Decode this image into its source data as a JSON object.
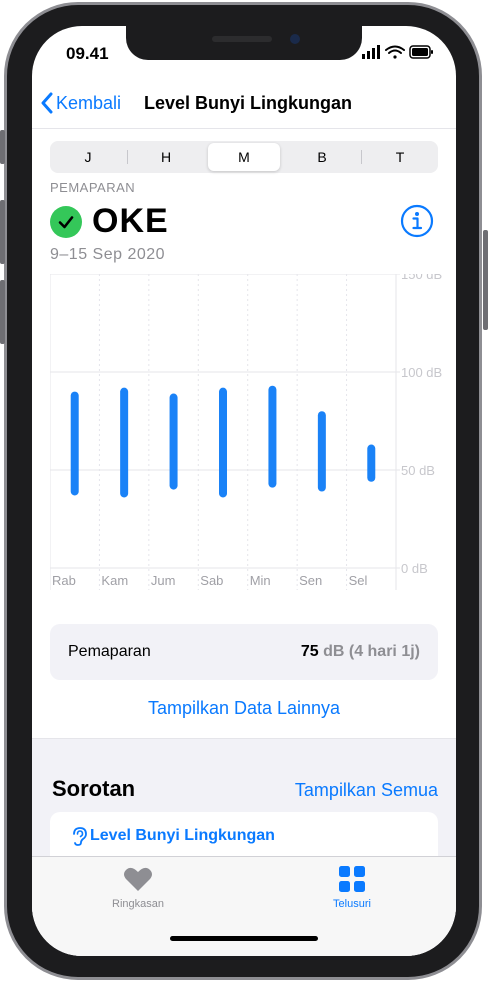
{
  "status_bar": {
    "time": "09.41"
  },
  "nav": {
    "back_label": "Kembali",
    "title": "Level Bunyi Lingkungan"
  },
  "segments": [
    {
      "label": "J",
      "active": false
    },
    {
      "label": "H",
      "active": false
    },
    {
      "label": "M",
      "active": true
    },
    {
      "label": "B",
      "active": false
    },
    {
      "label": "T",
      "active": false
    }
  ],
  "exposure": {
    "label": "PEMAPARAN",
    "status": "OKE",
    "date_range": "9–15 Sep 2020"
  },
  "chart_data": {
    "type": "bar",
    "subtype": "range",
    "categories": [
      "Rab",
      "Kam",
      "Jum",
      "Sab",
      "Min",
      "Sen",
      "Sel"
    ],
    "series": [
      {
        "low": [
          37,
          36,
          40,
          36,
          41,
          39,
          44
        ],
        "high": [
          90,
          92,
          89,
          92,
          93,
          80,
          63
        ]
      }
    ],
    "y_ticks": [
      "150 dB",
      "100 dB",
      "50 dB",
      "0 dB"
    ],
    "ylim": [
      0,
      150
    ],
    "bar_color": "#1a82f7"
  },
  "summary": {
    "label": "Pemaparan",
    "value_num": "75",
    "value_rest": " dB (4 hari 1j)"
  },
  "more_link": "Tampilkan Data Lainnya",
  "highlights": {
    "title": "Sorotan",
    "show_all": "Tampilkan Semua",
    "card_label": "Level Bunyi Lingkungan"
  },
  "tabbar": {
    "summary_label": "Ringkasan",
    "browse_label": "Telusuri"
  },
  "colors": {
    "accent": "#0a7aff",
    "ok_green": "#34c759"
  }
}
